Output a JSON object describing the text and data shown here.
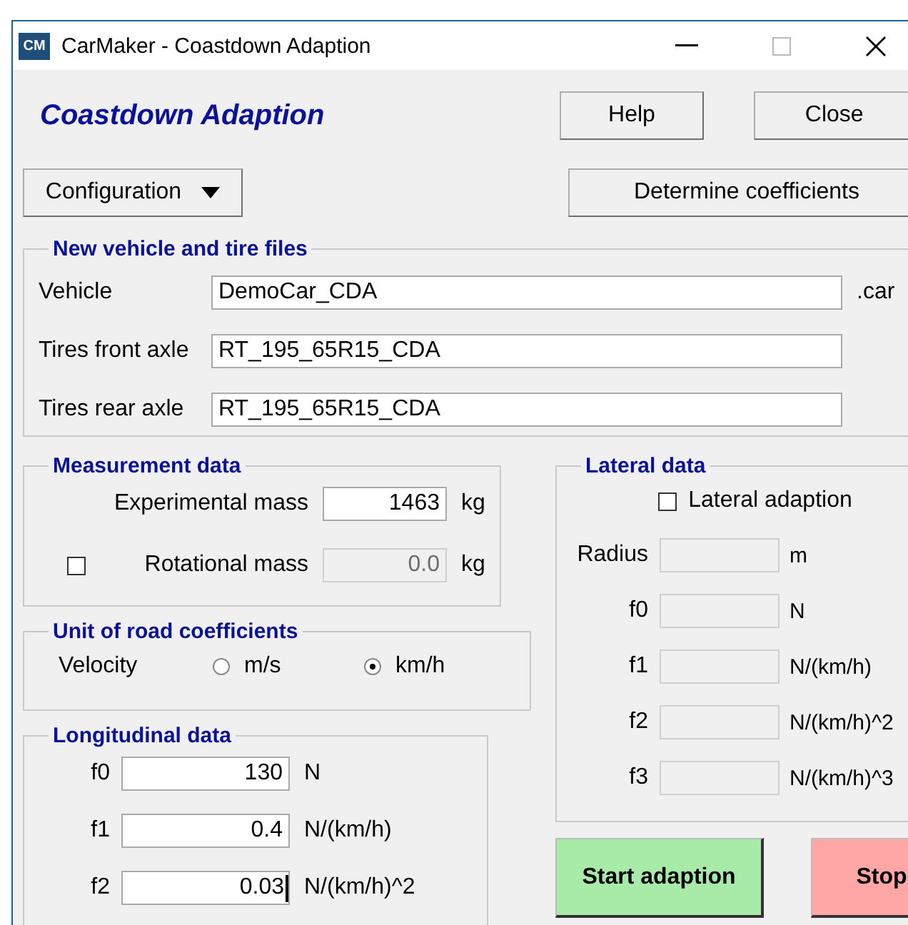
{
  "window": {
    "icon_text": "CM",
    "title": "CarMaker - Coastdown Adaption"
  },
  "header": {
    "title": "Coastdown Adaption",
    "buttons": [
      "Help",
      "Close"
    ]
  },
  "toolbar": {
    "dropdown": {
      "label": "Configuration"
    },
    "button": "Determine coefficients"
  },
  "vehicle_files": {
    "title": "New vehicle and tire files",
    "rows": [
      {
        "label": "Vehicle",
        "value": "DemoCar_CDA",
        "suffix": ".car"
      },
      {
        "label": "Tires front axle",
        "value": "RT_195_65R15_CDA"
      },
      {
        "label": "Tires rear axle",
        "value": "RT_195_65R15_CDA"
      }
    ]
  },
  "measurement": {
    "title": "Measurement data",
    "rows": [
      {
        "kind": "field",
        "label": "Experimental mass",
        "value": "1463",
        "unit": "kg",
        "disabled": false
      },
      {
        "kind": "checkbox",
        "checked": false,
        "label": "Rotational mass",
        "value": "0.0",
        "unit": "kg",
        "disabled": true
      }
    ]
  },
  "unit_of_road_coefficients": {
    "title": "Unit of road coefficients",
    "label": "Velocity",
    "options": [
      {
        "label": "m/s",
        "selected": false
      },
      {
        "label": "km/h",
        "selected": true
      }
    ]
  },
  "longitudinal": {
    "title": "Longitudinal data",
    "rows": [
      {
        "label": "f0",
        "value": "130",
        "unit": "N",
        "focused": false
      },
      {
        "label": "f1",
        "value": "0.4",
        "unit": "N/(km/h)",
        "focused": false
      },
      {
        "label": "f2",
        "value": "0.03",
        "unit": "N/(km/h)^2",
        "focused": true
      }
    ]
  },
  "lateral": {
    "title": "Lateral data",
    "checkbox": {
      "label": "Lateral adaption",
      "checked": false
    },
    "rows": [
      {
        "label": "Radius",
        "unit": "m",
        "disabled": true
      },
      {
        "label": "f0",
        "unit": "N",
        "disabled": true
      },
      {
        "label": "f1",
        "unit": "N/(km/h)",
        "disabled": true
      },
      {
        "label": "f2",
        "unit": "N/(km/h)^2",
        "disabled": true
      },
      {
        "label": "f3",
        "unit": "N/(km/h)^3",
        "disabled": true
      }
    ]
  },
  "actions": [
    {
      "kind": "start",
      "label": "Start adaption"
    },
    {
      "kind": "stop",
      "label": "Stop"
    }
  ]
}
